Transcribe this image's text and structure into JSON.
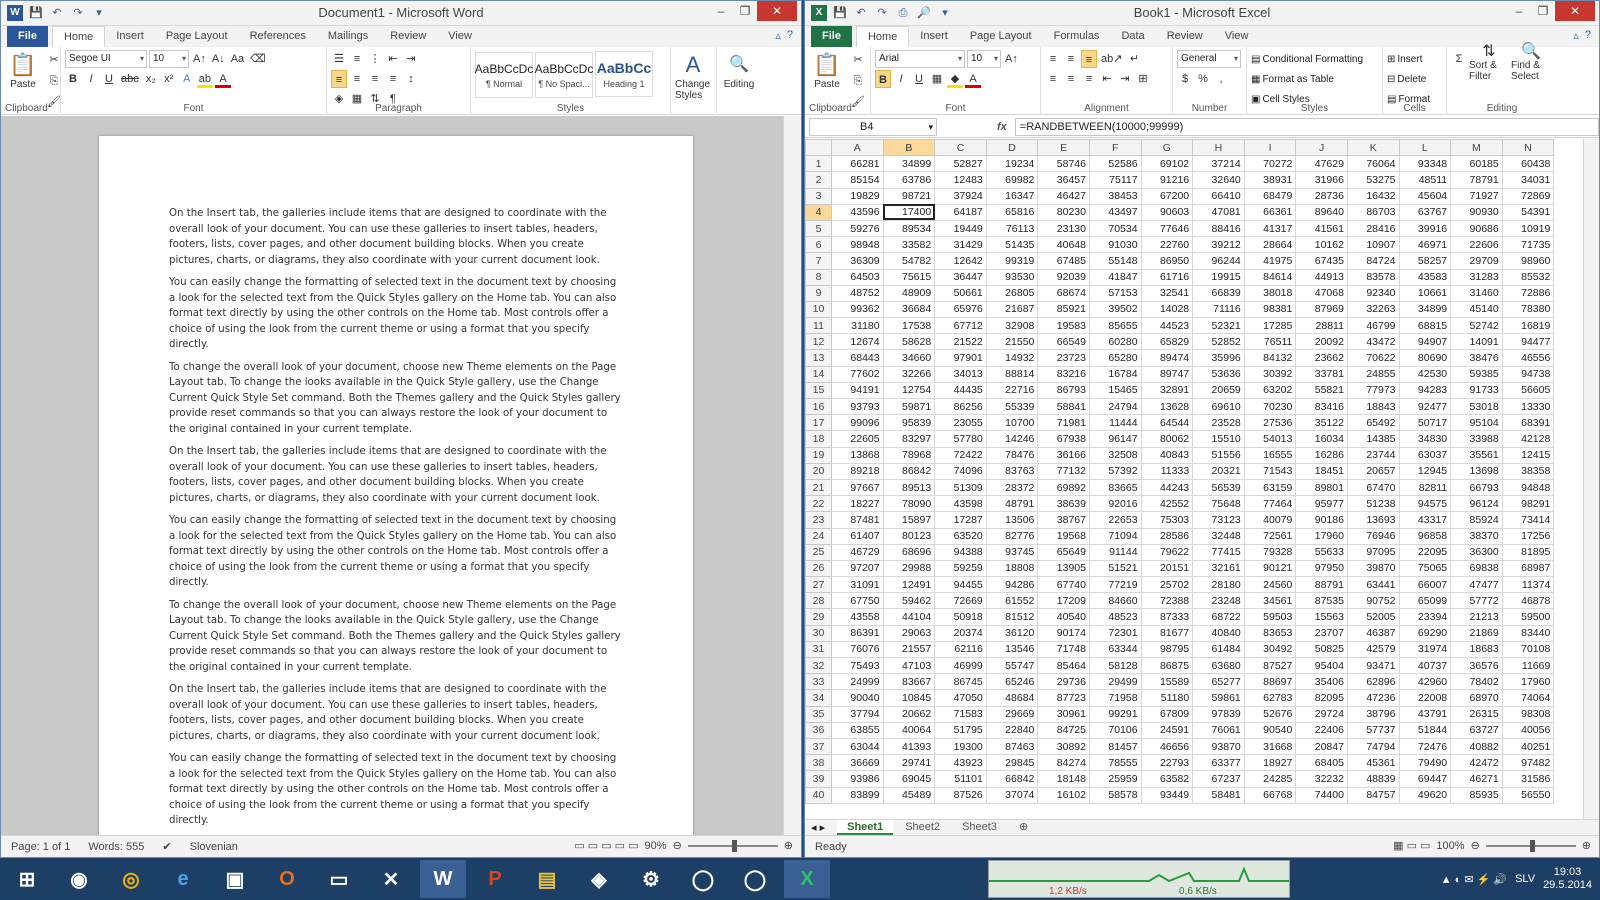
{
  "word": {
    "title": "Document1 - Microsoft Word",
    "tabs": {
      "file": "File",
      "home": "Home",
      "insert": "Insert",
      "page_layout": "Page Layout",
      "references": "References",
      "mailings": "Mailings",
      "review": "Review",
      "view": "View"
    },
    "font_name": "Segoe UI",
    "font_size": "10",
    "clipboard": {
      "paste": "Paste",
      "label": "Clipboard"
    },
    "groups": {
      "font": "Font",
      "paragraph": "Paragraph",
      "styles": "Styles"
    },
    "styles": [
      {
        "preview": "AaBbCcDc",
        "label": "¶ Normal"
      },
      {
        "preview": "AaBbCcDc",
        "label": "¶ No Spaci..."
      },
      {
        "preview": "AaBbCc",
        "label": "Heading 1"
      }
    ],
    "change_styles": "Change Styles",
    "editing": "Editing",
    "paragraphs": [
      "On the Insert tab, the galleries include items that are designed to coordinate with the overall look of your document. You can use these galleries to insert tables, headers, footers, lists, cover pages, and other document building blocks. When you create pictures, charts, or diagrams, they also coordinate with your current document look.",
      "You can easily change the formatting of selected text in the document text by choosing a look for the selected text from the Quick Styles gallery on the Home tab. You can also format text directly by using the other controls on the Home tab. Most controls offer a choice of using the look from the current theme or using a format that you specify directly.",
      "To change the overall look of your document, choose new Theme elements on the Page Layout tab. To change the looks available in the Quick Style gallery, use the Change Current Quick Style Set command. Both the Themes gallery and the Quick Styles gallery provide reset commands so that you can always restore the look of your document to the original contained in your current template.",
      "On the Insert tab, the galleries include items that are designed to coordinate with the overall look of your document. You can use these galleries to insert tables, headers, footers, lists, cover pages, and other document building blocks. When you create pictures, charts, or diagrams, they also coordinate with your current document look.",
      "You can easily change the formatting of selected text in the document text by choosing a look for the selected text from the Quick Styles gallery on the Home tab. You can also format text directly by using the other controls on the Home tab. Most controls offer a choice of using the look from the current theme or using a format that you specify directly.",
      "To change the overall look of your document, choose new Theme elements on the Page Layout tab. To change the looks available in the Quick Style gallery, use the Change Current Quick Style Set command. Both the Themes gallery and the Quick Styles gallery provide reset commands so that you can always restore the look of your document to the original contained in your current template.",
      "On the Insert tab, the galleries include items that are designed to coordinate with the overall look of your document. You can use these galleries to insert tables, headers, footers, lists, cover pages, and other document building blocks. When you create pictures, charts, or diagrams, they also coordinate with your current document look.",
      "You can easily change the formatting of selected text in the document text by choosing a look for the selected text from the Quick Styles gallery on the Home tab. You can also format text directly by using the other controls on the Home tab. Most controls offer a choice of using the look from the current theme or using a format that you specify directly.",
      "To change the overall look of your document, choose new Theme elements on the Page Layout tab. To change the looks available in the Quick Style gallery, use the Change Current Quick Style Set command. Both the Themes gallery and the Quick Styles gallery provide reset commands so that you can always restore the look of your document to the original contained in your current template."
    ],
    "status": {
      "page": "Page: 1 of 1",
      "words": "Words: 555",
      "language": "Slovenian",
      "zoom": "90%"
    }
  },
  "excel": {
    "title": "Book1 - Microsoft Excel",
    "tabs": {
      "file": "File",
      "home": "Home",
      "insert": "Insert",
      "page_layout": "Page Layout",
      "formulas": "Formulas",
      "data": "Data",
      "review": "Review",
      "view": "View"
    },
    "font_name": "Arial",
    "font_size": "10",
    "number_format": "General",
    "groups": {
      "clipboard": "Clipboard",
      "font": "Font",
      "alignment": "Alignment",
      "number": "Number",
      "styles": "Styles",
      "cells": "Cells",
      "editing": "Editing"
    },
    "buttons": {
      "paste": "Paste",
      "conditional": "Conditional Formatting",
      "format_table": "Format as Table",
      "cell_styles": "Cell Styles",
      "insert": "Insert",
      "delete": "Delete",
      "format": "Format",
      "sort": "Sort & Filter",
      "find": "Find & Select"
    },
    "name_box": "B4",
    "fx": "fx",
    "formula": "=RANDBETWEEN(10000;99999)",
    "columns": [
      "A",
      "B",
      "C",
      "D",
      "E",
      "F",
      "G",
      "H",
      "I",
      "J",
      "K",
      "L",
      "M",
      "N"
    ],
    "rows": [
      [
        66281,
        34899,
        52827,
        19234,
        58746,
        52586,
        69102,
        37214,
        70272,
        47629,
        76064,
        93348,
        60185,
        60438
      ],
      [
        85154,
        63786,
        12483,
        69982,
        36457,
        75117,
        91216,
        32640,
        38931,
        31966,
        53275,
        48511,
        78791,
        34031
      ],
      [
        19829,
        98721,
        37924,
        16347,
        46427,
        38453,
        67200,
        66410,
        68479,
        28736,
        16432,
        45604,
        71927,
        72869
      ],
      [
        43596,
        17400,
        64187,
        65816,
        80230,
        43497,
        90603,
        47081,
        66361,
        89640,
        86703,
        63767,
        90930,
        54391
      ],
      [
        59276,
        89534,
        19449,
        76113,
        23130,
        70534,
        77646,
        88416,
        41317,
        41561,
        28416,
        39916,
        90686,
        10919
      ],
      [
        98948,
        33582,
        31429,
        51435,
        40648,
        91030,
        22760,
        39212,
        28664,
        10162,
        10907,
        46971,
        22606,
        71735
      ],
      [
        36309,
        54782,
        12642,
        99319,
        67485,
        55148,
        86950,
        96244,
        41975,
        67435,
        84724,
        58257,
        29709,
        98960
      ],
      [
        64503,
        75615,
        36447,
        93530,
        92039,
        41847,
        61716,
        19915,
        84614,
        44913,
        83578,
        43583,
        31283,
        85532
      ],
      [
        48752,
        48909,
        50661,
        26805,
        68674,
        57153,
        32541,
        66839,
        38018,
        47068,
        92340,
        10661,
        31460,
        72886
      ],
      [
        99362,
        36684,
        65976,
        21687,
        85921,
        39502,
        14028,
        71116,
        98381,
        87969,
        32263,
        34899,
        45140,
        78380
      ],
      [
        31180,
        17538,
        67712,
        32908,
        19583,
        85655,
        44523,
        52321,
        17285,
        28811,
        46799,
        68815,
        52742,
        16819
      ],
      [
        12674,
        58628,
        21522,
        21550,
        66549,
        60280,
        65829,
        52852,
        76511,
        20092,
        43472,
        94907,
        14091,
        94477
      ],
      [
        68443,
        34660,
        97901,
        14932,
        23723,
        65280,
        89474,
        35996,
        84132,
        23662,
        70622,
        80690,
        38476,
        46556
      ],
      [
        77602,
        32266,
        34013,
        88814,
        83216,
        16784,
        89747,
        53636,
        30392,
        33781,
        24855,
        42530,
        59385,
        94738
      ],
      [
        94191,
        12754,
        44435,
        22716,
        86793,
        15465,
        32891,
        20659,
        63202,
        55821,
        77973,
        94283,
        91733,
        56605
      ],
      [
        93793,
        59871,
        86256,
        55339,
        58841,
        24794,
        13628,
        69610,
        70230,
        83416,
        18843,
        92477,
        53018,
        13330
      ],
      [
        99096,
        95839,
        23055,
        10700,
        71981,
        11444,
        64544,
        23528,
        27536,
        35122,
        65492,
        50717,
        95104,
        68391
      ],
      [
        22605,
        83297,
        57780,
        14246,
        67938,
        96147,
        80062,
        15510,
        54013,
        16034,
        14385,
        34830,
        33988,
        42128
      ],
      [
        13868,
        78968,
        72422,
        78476,
        36166,
        32508,
        40843,
        51556,
        16555,
        16286,
        23744,
        63037,
        35561,
        12415
      ],
      [
        89218,
        86842,
        74096,
        83763,
        77132,
        57392,
        11333,
        20321,
        71543,
        18451,
        20657,
        12945,
        13698,
        38358
      ],
      [
        97667,
        89513,
        51309,
        28372,
        69892,
        83665,
        44243,
        56539,
        63159,
        89801,
        67470,
        82811,
        66793,
        94848
      ],
      [
        18227,
        78090,
        43598,
        48791,
        38639,
        92016,
        42552,
        75648,
        77464,
        95977,
        51238,
        94575,
        96124,
        98291
      ],
      [
        87481,
        15897,
        17287,
        13506,
        38767,
        22653,
        75303,
        73123,
        40079,
        90186,
        13693,
        43317,
        85924,
        73414
      ],
      [
        61407,
        80123,
        63520,
        82776,
        19568,
        71094,
        28586,
        32448,
        72561,
        17960,
        76946,
        96858,
        38370,
        17256
      ],
      [
        46729,
        68696,
        94388,
        93745,
        65649,
        91144,
        79622,
        77415,
        79328,
        55633,
        97095,
        22095,
        36300,
        81895
      ],
      [
        97207,
        29988,
        59259,
        18808,
        13905,
        51521,
        20151,
        32161,
        90121,
        97950,
        39870,
        75065,
        69838,
        68987
      ],
      [
        31091,
        12491,
        94455,
        94286,
        67740,
        77219,
        25702,
        28180,
        24560,
        88791,
        63441,
        66007,
        47477,
        11374
      ],
      [
        67750,
        59462,
        72669,
        61552,
        17209,
        84660,
        72388,
        23248,
        34561,
        87535,
        90752,
        65099,
        57772,
        46878
      ],
      [
        43558,
        44104,
        50918,
        81512,
        40540,
        48523,
        87333,
        68722,
        59503,
        15563,
        52005,
        23394,
        21213,
        59500
      ],
      [
        86391,
        29063,
        20374,
        36120,
        90174,
        72301,
        81677,
        40840,
        83653,
        23707,
        46387,
        69290,
        21869,
        83440
      ],
      [
        76076,
        21557,
        62116,
        13546,
        71748,
        63344,
        98795,
        61484,
        30492,
        50825,
        42579,
        31974,
        18683,
        70108
      ],
      [
        75493,
        47103,
        46999,
        55747,
        85464,
        58128,
        86875,
        63680,
        87527,
        95404,
        93471,
        40737,
        36576,
        11669
      ],
      [
        24999,
        83667,
        86745,
        65246,
        29736,
        29499,
        15589,
        65277,
        88697,
        35406,
        62896,
        42960,
        78402,
        17960
      ],
      [
        90040,
        10845,
        47050,
        48684,
        87723,
        71958,
        51180,
        59861,
        62783,
        82095,
        47236,
        22008,
        68970,
        74064
      ],
      [
        37794,
        20662,
        71583,
        29669,
        30961,
        99291,
        67809,
        97839,
        52676,
        29724,
        38796,
        43791,
        26315,
        98308
      ],
      [
        63855,
        40064,
        51795,
        22840,
        84725,
        70106,
        24591,
        76061,
        90540,
        22406,
        57737,
        51844,
        63727,
        40056
      ],
      [
        63044,
        41393,
        19300,
        87463,
        30892,
        81457,
        46656,
        93870,
        31668,
        20847,
        74794,
        72476,
        40882,
        40251
      ],
      [
        36669,
        29741,
        43923,
        29845,
        84274,
        78555,
        22793,
        63377,
        18927,
        68405,
        45361,
        79490,
        42472,
        97482
      ],
      [
        93986,
        69045,
        51101,
        66842,
        18148,
        25959,
        63582,
        67237,
        24285,
        32232,
        48839,
        69447,
        46271,
        31586
      ],
      [
        83899,
        45489,
        87526,
        37074,
        16102,
        58578,
        93449,
        58481,
        66768,
        74400,
        84757,
        49620,
        85935,
        56550
      ]
    ],
    "sheets": [
      "Sheet1",
      "Sheet2",
      "Sheet3"
    ],
    "status": {
      "ready": "Ready",
      "zoom": "100%"
    }
  },
  "taskbar": {
    "net_down": "1,2 KB/s",
    "net_up": "0,6 KB/s",
    "lang": "SLV",
    "time": "19:03",
    "date": "29.5.2014"
  },
  "colors": {
    "word_accent": "#2b579a",
    "excel_accent": "#217346"
  }
}
